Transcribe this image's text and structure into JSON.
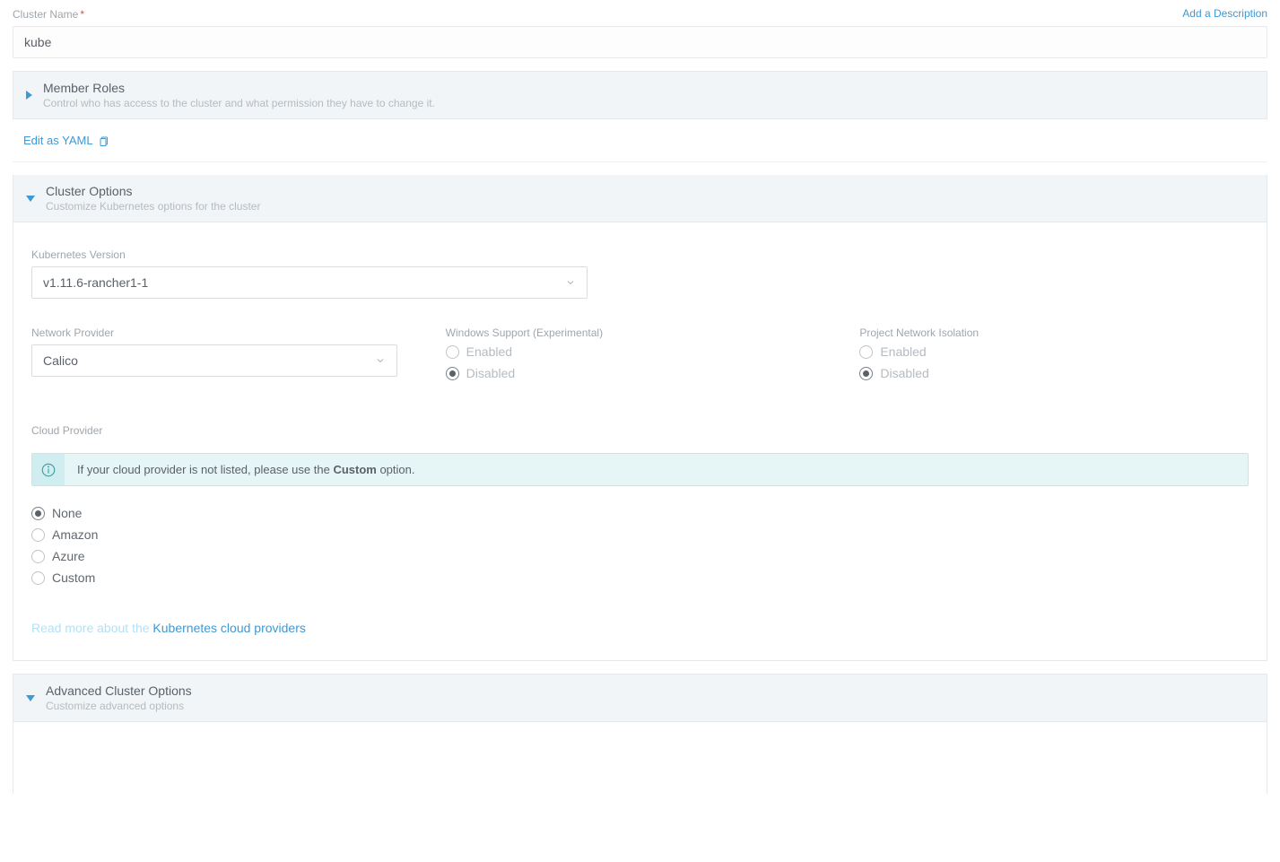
{
  "header": {
    "name_label": "Cluster Name",
    "add_description": "Add a Description"
  },
  "form": {
    "cluster_name": "kube"
  },
  "panels": {
    "member": {
      "title": "Member Roles",
      "subtitle": "Control who has access to the cluster and what permission they have to change it."
    },
    "options": {
      "title": "Cluster Options",
      "subtitle": "Customize Kubernetes options for the cluster"
    },
    "advanced": {
      "title": "Advanced Cluster Options",
      "subtitle": "Customize advanced options"
    }
  },
  "links": {
    "edit_yaml": "Edit as YAML",
    "read_more_prefix": "Read more about the ",
    "read_more_link": "Kubernetes cloud providers"
  },
  "k8s": {
    "version_label": "Kubernetes Version",
    "version_value": "v1.11.6-rancher1-1"
  },
  "network": {
    "provider_label": "Network Provider",
    "provider_value": "Calico"
  },
  "windows": {
    "label": "Windows Support (Experimental)",
    "enabled": "Enabled",
    "disabled": "Disabled"
  },
  "isolation": {
    "label": "Project Network Isolation",
    "enabled": "Enabled",
    "disabled": "Disabled"
  },
  "cloud": {
    "label": "Cloud Provider",
    "info_prefix": "If your cloud provider is not listed, please use the ",
    "info_bold": "Custom",
    "info_suffix": " option.",
    "options": {
      "none": "None",
      "amazon": "Amazon",
      "azure": "Azure",
      "custom": "Custom"
    }
  }
}
